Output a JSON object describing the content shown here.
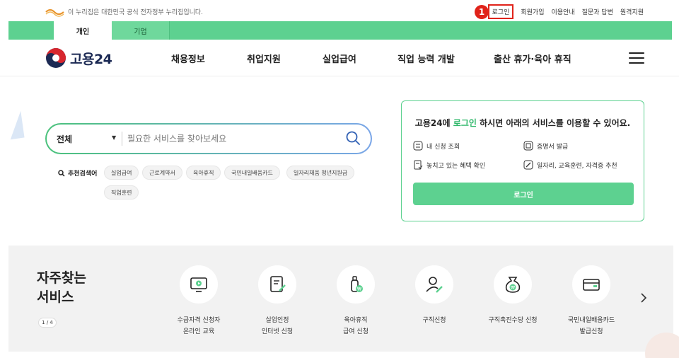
{
  "gov_bar": {
    "notice": "이 누리집은 대한민국 공식 전자정부 누리집입니다.",
    "links": [
      "로그인",
      "회원가입",
      "이용안내",
      "질문과 답변",
      "원격지원"
    ],
    "marker": "1"
  },
  "user_types": [
    "개인",
    "기업"
  ],
  "header": {
    "brand": "고용24",
    "nav": [
      "채용정보",
      "취업지원",
      "실업급여",
      "직업 능력 개발",
      "출산 휴가·육아 휴직"
    ]
  },
  "search": {
    "category": "전체",
    "placeholder": "필요한 서비스를 찾아보세요",
    "recommended_label": "추천검색어",
    "chips": [
      "실업급여",
      "근로계약서",
      "육아휴직",
      "국민내일배움카드",
      "일자리채움 청년지원금",
      "직업훈련"
    ]
  },
  "login_card": {
    "title_prefix": "고용24에 ",
    "title_highlight": "로그인",
    "title_suffix": " 하시면 아래의 서비스를 이용할 수 있어요.",
    "items": [
      "내 신청 조회",
      "증명서 발급",
      "놓치고 있는 혜택 확인",
      "일자리, 교육훈련, 자격증 추천"
    ],
    "button": "로그인"
  },
  "frequent": {
    "title": "자주찾는\n서비스",
    "page": "1 / 4",
    "services": [
      {
        "label": "수급자격 신청자\n온라인 교육",
        "icon": "monitor-play-icon"
      },
      {
        "label": "실업인정\n인터넷 신청",
        "icon": "document-pen-icon"
      },
      {
        "label": "육아휴직\n급여 신청",
        "icon": "baby-bottle-icon"
      },
      {
        "label": "구직신청",
        "icon": "person-pen-icon"
      },
      {
        "label": "구직촉진수당 신청",
        "icon": "money-bag-icon"
      },
      {
        "label": "국민내일배움카드\n발급신청",
        "icon": "card-icon"
      }
    ]
  },
  "colors": {
    "accent": "#5dd190",
    "highlight": "#2fb76a",
    "marker": "#e0231a",
    "brand_text": "#1c2a54"
  }
}
